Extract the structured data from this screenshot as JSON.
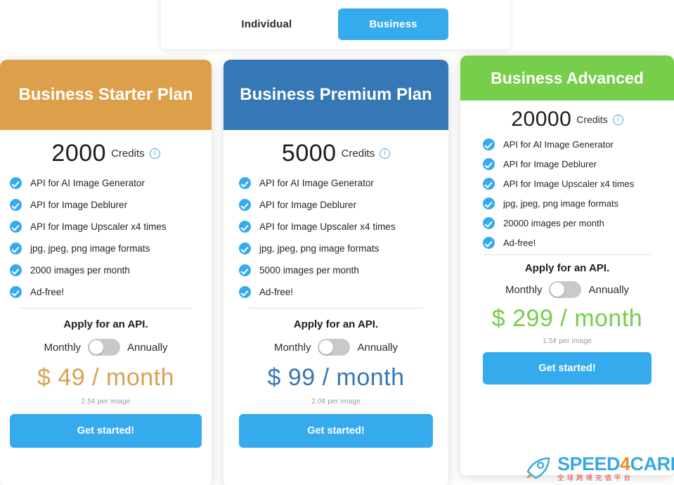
{
  "tabs": {
    "individual_label": "Individual",
    "business_label": "Business",
    "active": "Business",
    "active_color": "#35ABEE"
  },
  "common": {
    "credits_label": "Credits",
    "info_icon": "info-circle-icon",
    "apply_text": "Apply for an API.",
    "monthly_label": "Monthly",
    "annually_label": "Annually",
    "cta_label": "Get started!",
    "check_icon": "check-circle-icon",
    "toggle_state": "monthly"
  },
  "plans": [
    {
      "title": "Business Starter Plan",
      "header_color": "#DDA04A",
      "credits": "2000",
      "features": [
        "API for AI Image Generator",
        "API for Image Deblurer",
        "API for Image Upscaler x4 times",
        "jpg, jpeg, png image formats",
        "2000 images per month",
        "Ad-free!"
      ],
      "price": "$ 49 / month",
      "price_color": "#D8A253",
      "per_image": "2.5¢ per image"
    },
    {
      "title": "Business Premium Plan",
      "header_color": "#3578B5",
      "credits": "5000",
      "features": [
        "API for AI Image Generator",
        "API for Image Deblurer",
        "API for Image Upscaler x4 times",
        "jpg, jpeg, png image formats",
        "5000 images per month",
        "Ad-free!"
      ],
      "price": "$ 99 / month",
      "price_color": "#3578B5",
      "per_image": "2.0¢ per image"
    },
    {
      "title": "Business Advanced",
      "header_color": "#76CE4A",
      "credits": "20000",
      "features": [
        "API for AI Image Generator",
        "API for Image Deblurer",
        "API for Image Upscaler x4 times",
        "jpg, jpeg, png image formats",
        "20000 images per month",
        "Ad-free!"
      ],
      "price": "$ 299 / month",
      "price_color": "#76CE4A",
      "per_image": "1.5¢ per image"
    }
  ],
  "watermark": {
    "brand_part1": "SPEED",
    "brand_four": "4",
    "brand_part2": "CARD",
    "subtitle": "全球跨境充值平台",
    "icon": "rocket-icon"
  }
}
